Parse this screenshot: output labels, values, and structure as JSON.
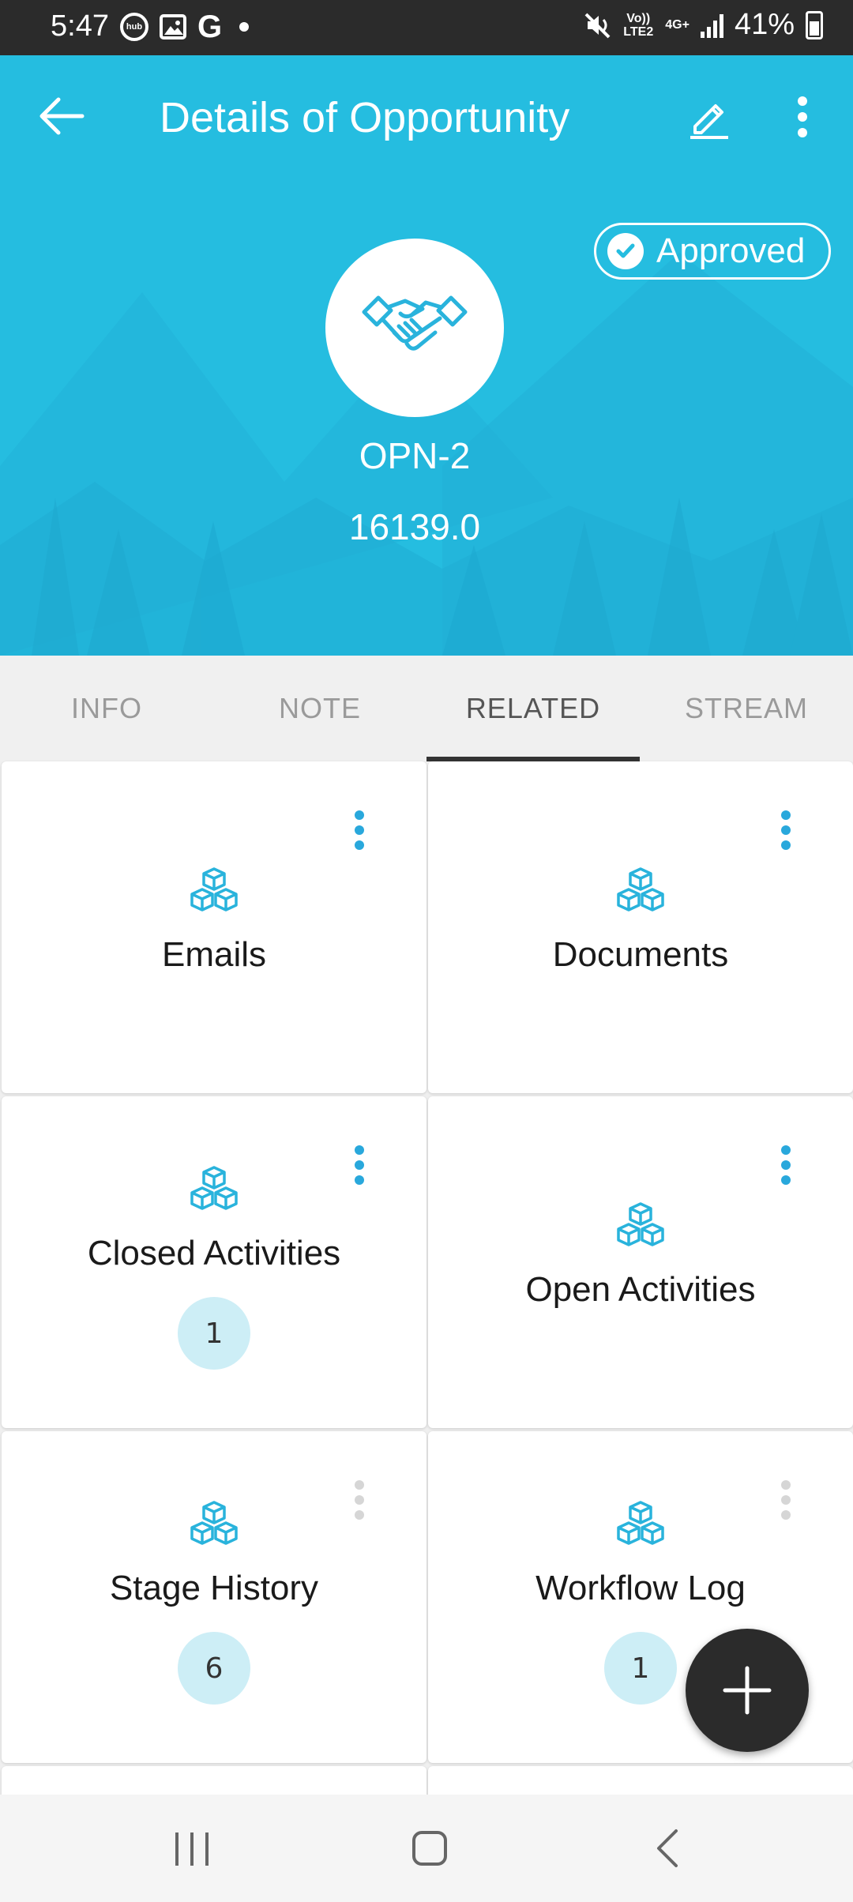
{
  "status_bar": {
    "time": "5:47",
    "hub_icon_text": "hub",
    "g_icon_text": "G",
    "volte_text": "Vo)) LTE2",
    "network_text": "4G+",
    "battery": "41%"
  },
  "header": {
    "title": "Details of Opportunity",
    "status_badge": "Approved",
    "record_id": "OPN-2",
    "amount": "16139.0",
    "accent_color": "#25bde0"
  },
  "tabs": [
    {
      "label": "INFO",
      "active": false
    },
    {
      "label": "NOTE",
      "active": false
    },
    {
      "label": "RELATED",
      "active": true
    },
    {
      "label": "STREAM",
      "active": false
    }
  ],
  "related": {
    "emails": {
      "label": "Emails"
    },
    "documents": {
      "label": "Documents"
    },
    "closed_activities": {
      "label": "Closed Activities",
      "count": "1"
    },
    "open_activities": {
      "label": "Open Activities"
    },
    "stage_history": {
      "label": "Stage History",
      "count": "6"
    },
    "workflow_log": {
      "label": "Workflow Log",
      "count": "1"
    }
  },
  "icons": {
    "back": "arrow-left-icon",
    "edit": "pencil-icon",
    "more": "more-vertical-icon",
    "avatar": "handshake-icon",
    "card": "cubes-icon",
    "fab": "plus-icon"
  }
}
